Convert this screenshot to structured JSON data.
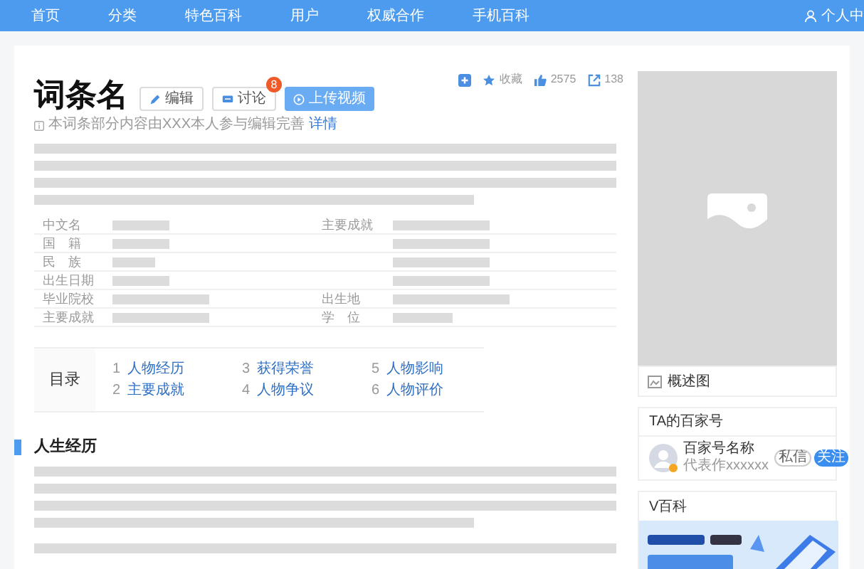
{
  "nav": {
    "items": [
      {
        "label": "首页"
      },
      {
        "label": "分类"
      },
      {
        "label": "特色百科"
      },
      {
        "label": "用户"
      },
      {
        "label": "权威合作"
      },
      {
        "label": "手机百科"
      }
    ],
    "user_menu": "个人中"
  },
  "entry": {
    "title": "词条名",
    "buttons": [
      {
        "kind": "edit",
        "label": "编辑"
      },
      {
        "kind": "discuss",
        "label": "讨论",
        "badge": "8"
      },
      {
        "kind": "upload",
        "label": "上传视频"
      }
    ],
    "actions": [
      {
        "kind": "add"
      },
      {
        "kind": "favorite",
        "label": "收藏"
      },
      {
        "kind": "like",
        "label": "2575"
      },
      {
        "kind": "share",
        "label": "138"
      }
    ],
    "notice": {
      "text": "本词条部分内容由XXX本人参与编辑完善",
      "link": "详情"
    }
  },
  "info_table": {
    "rows": [
      {
        "left_label": "中文名",
        "right_label": "主要成就"
      },
      {
        "left_label": "国　籍"
      },
      {
        "left_label": "民　族"
      },
      {
        "left_label": "出生日期"
      },
      {
        "left_label": "毕业院校",
        "right_label": "出生地"
      },
      {
        "left_label": "主要成就",
        "right_label": "学　位"
      }
    ]
  },
  "toc": {
    "title": "目录",
    "items": [
      {
        "number": "1",
        "label": "人物经历"
      },
      {
        "number": "2",
        "label": "主要成就"
      },
      {
        "number": "3",
        "label": "获得荣誉"
      },
      {
        "number": "4",
        "label": "人物争议"
      },
      {
        "number": "5",
        "label": "人物影响"
      },
      {
        "number": "6",
        "label": "人物评价"
      }
    ]
  },
  "section": {
    "heading": "人生经历"
  },
  "sidebar": {
    "album_caption": "概述图",
    "baijiahao": {
      "title": "TA的百家号",
      "name": "百家号名称",
      "subtitle": "代表作xxxxxx",
      "buttons": [
        {
          "kind": "outline",
          "label": "私信"
        },
        {
          "kind": "primary",
          "label": "关注"
        }
      ]
    },
    "vbaike": {
      "title": "V百科"
    }
  }
}
